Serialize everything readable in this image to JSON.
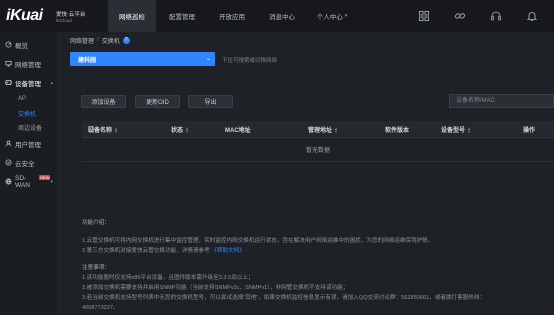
{
  "brand": {
    "logo_text": "iKuai",
    "name": "爱快·云平台",
    "sub": "iKCloud"
  },
  "nav": [
    {
      "label": "网络巡检",
      "active": true,
      "caret": false
    },
    {
      "label": "配置管理",
      "active": false,
      "caret": false
    },
    {
      "label": "开放应用",
      "active": false,
      "caret": false
    },
    {
      "label": "消息中心",
      "active": false,
      "caret": false
    },
    {
      "label": "个人中心",
      "active": false,
      "caret": true
    }
  ],
  "top_icons": [
    "grid-icon",
    "link-icon",
    "headset-icon",
    "bell-icon"
  ],
  "sidebar": {
    "items": [
      {
        "label": "概览",
        "icon": "overview-icon"
      },
      {
        "label": "网络管理",
        "icon": "network-icon"
      },
      {
        "label": "设备管理",
        "icon": "device-icon"
      },
      {
        "label": "用户管理",
        "icon": "user-icon"
      },
      {
        "label": "云安全",
        "icon": "cloud-security-icon"
      },
      {
        "label": "SD-WAN",
        "icon": "sdwan-icon",
        "badge": "NEW"
      }
    ],
    "sub_items": [
      {
        "label": "AP",
        "active": false
      },
      {
        "label": "交换机",
        "active": true
      },
      {
        "label": "周边设备",
        "active": false
      }
    ]
  },
  "breadcrumb": {
    "part1": "网络管理",
    "sep": "/",
    "part2": "交换机",
    "help": "?"
  },
  "site_select": {
    "value": "建科园",
    "hint": "下拉可搜索或切换网络"
  },
  "toolbar": {
    "add": "添加设备",
    "refresh": "更新OID",
    "export": "导出"
  },
  "search": {
    "placeholder": "设备名称/MAC"
  },
  "table": {
    "columns": [
      "设备名称",
      "状态",
      "MAC地址",
      "管理地址",
      "软件版本",
      "设备型号",
      "操作"
    ],
    "empty_text": "暂无数据"
  },
  "info": {
    "title": "功能介绍：",
    "intro": [
      "1.云管交换机可将内网交换机进行集中监控管理，实时监控内网交换机运行状态，旨在解决用户网络运维中的困扰，为您的网络运维保驾护航。",
      "2.第三方交换机对接爱快云管交换功能，详情请参考 "
    ],
    "link": "《帮助文档》",
    "notes_title": "注意事项：",
    "notes": [
      "1.该功能暂时仅支持x86平台设备，且固件版本需升级至3.3.5及以上；",
      "2.被添加交换机需要支持并启用SNMP功能（当前支持SNMPv2c、SNMPv1），非网管交换机不支持该功能；",
      "3.若当前交换机支持型号列表中无您的交换机型号，可以尝试选择“其他”，如果交换机监控信息显示有误，请加入QQ交流讨论群：562850661，或者拨打客服热线：",
      "4008773227。"
    ]
  },
  "colors": {
    "accent": "#2f86ff",
    "topbar": "#16181c",
    "sidebar": "#1a1d21",
    "background": "#1e2126",
    "badge": "#e0424b"
  }
}
